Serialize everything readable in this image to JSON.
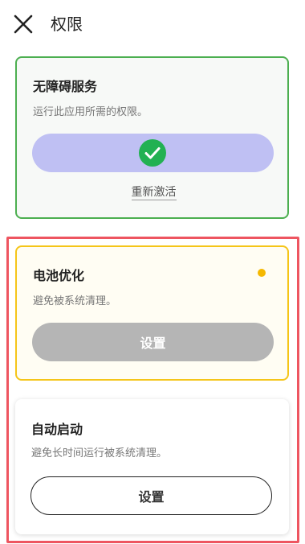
{
  "header": {
    "title": "权限",
    "close_icon": "close-icon"
  },
  "permissions": [
    {
      "title": "无障碍服务",
      "description": "运行此应用所需的权限。",
      "status": "granted",
      "status_icon": "check-circle-icon",
      "action_label": "重新激活",
      "border_color": "#4caf50",
      "button_color": "#bfc0f3",
      "check_color": "#22b152"
    },
    {
      "title": "电池优化",
      "description": "避免被系统清理。",
      "status": "pending",
      "button_label": "设置",
      "button_state": "disabled",
      "border_color": "#f5c518",
      "dot_color": "#f5b800"
    },
    {
      "title": "自动启动",
      "description": "避免长时间运行被系统清理。",
      "button_label": "设置",
      "button_state": "enabled"
    }
  ],
  "highlight_color": "#ee5560"
}
